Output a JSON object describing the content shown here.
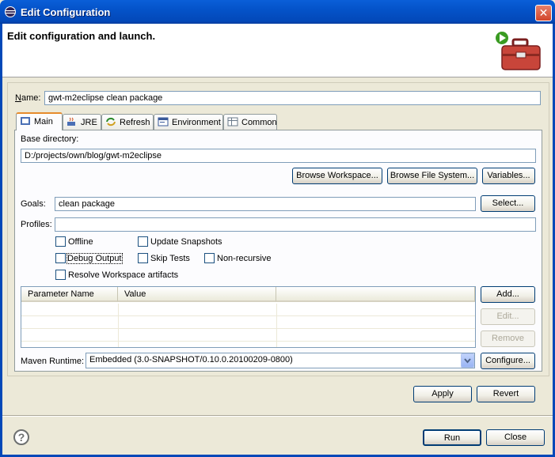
{
  "window": {
    "title": "Edit Configuration",
    "close_glyph": "✕",
    "icon": "eclipse-icon"
  },
  "banner": {
    "title": "Edit configuration and launch.",
    "icon": "run-toolbox-icon"
  },
  "name": {
    "label": "Name:",
    "label_mnemonic": "N",
    "label_rest": "ame:",
    "value": "gwt-m2eclipse clean package"
  },
  "tabs": [
    {
      "label": "Main",
      "icon": "m2-icon",
      "active": true
    },
    {
      "label": "JRE",
      "icon": "jre-icon",
      "active": false
    },
    {
      "label": "Refresh",
      "icon": "refresh-icon",
      "active": false
    },
    {
      "label": "Environment",
      "icon": "environment-icon",
      "active": false
    },
    {
      "label": "Common",
      "icon": "common-icon",
      "active": false
    }
  ],
  "main": {
    "base_dir_label": "Base directory:",
    "base_dir_value": "D:/projects/own/blog/gwt-m2eclipse",
    "browse_workspace": "Browse Workspace...",
    "browse_filesystem": "Browse File System...",
    "variables": "Variables...",
    "goals_label": "Goals:",
    "goals_value": "clean package",
    "select_button": "Select...",
    "profiles_label": "Profiles:",
    "profiles_value": "",
    "checkboxes": [
      {
        "label": "Offline",
        "checked": false
      },
      {
        "label": "Update Snapshots",
        "checked": false
      },
      {
        "label": "Debug Output",
        "checked": false
      },
      {
        "label": "Skip Tests",
        "checked": false
      },
      {
        "label": "Non-recursive",
        "checked": false
      },
      {
        "label": "Resolve Workspace artifacts",
        "checked": false
      }
    ],
    "params_table": {
      "columns": [
        "Parameter Name",
        "Value"
      ],
      "rows": []
    },
    "add_button": "Add...",
    "edit_button": "Edit...",
    "remove_button": "Remove",
    "runtime_label": "Maven Runtime:",
    "runtime_value": "Embedded (3.0-SNAPSHOT/0.10.0.20100209-0800)",
    "configure_button": "Configure..."
  },
  "apply_button": "Apply",
  "revert_button": "Revert",
  "run_button": "Run",
  "close_button": "Close",
  "help_glyph": "?"
}
